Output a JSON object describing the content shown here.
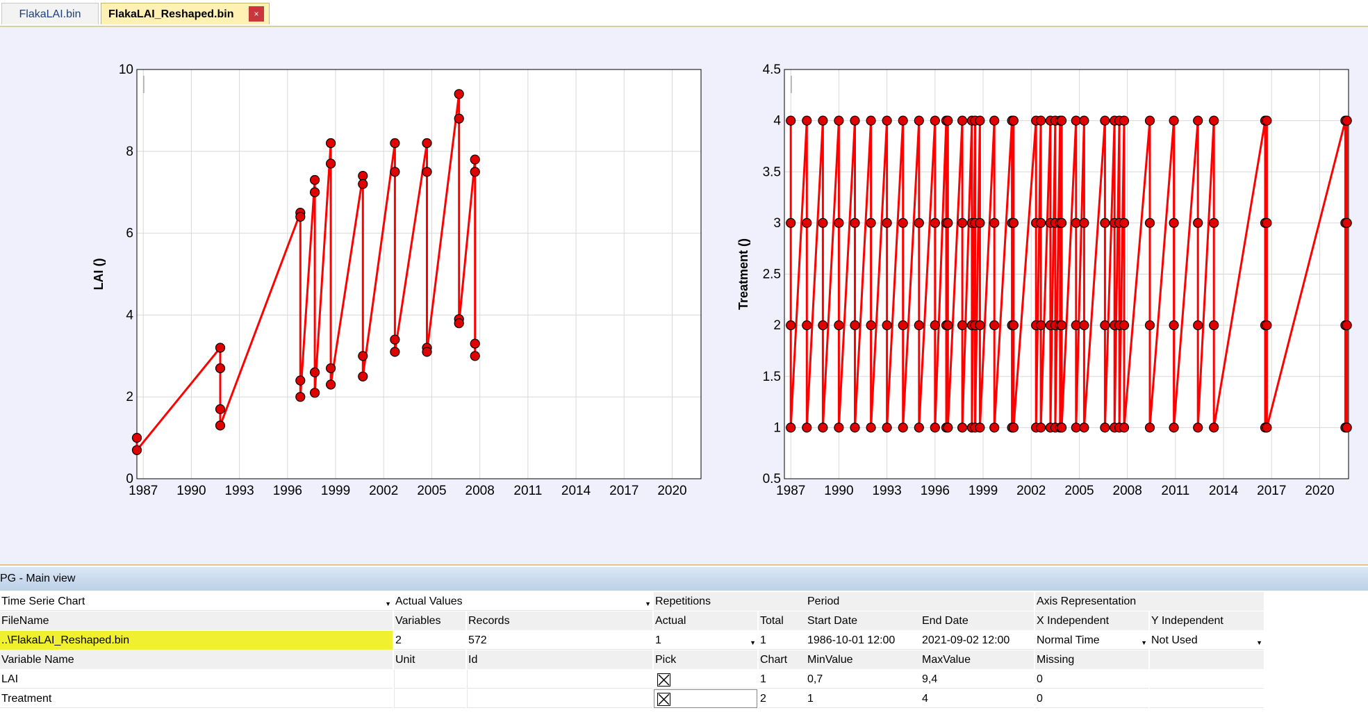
{
  "tabs": [
    {
      "label": "FlakaLAI.bin"
    },
    {
      "label": "FlakaLAI_Reshaped.bin",
      "close_icon": "close-icon"
    }
  ],
  "panel": {
    "title": "PG - Main view"
  },
  "grid": {
    "row0": {
      "chart_type": "Time Serie Chart",
      "value_type": "Actual Values",
      "repetitions": "Repetitions",
      "period": "Period",
      "axis_rep": "Axis Representation"
    },
    "row1": {
      "filename": "FileName",
      "variables": "Variables",
      "records": "Records",
      "actual": "Actual",
      "total": "Total",
      "start_date": "Start Date",
      "end_date": "End Date",
      "x_indep": "X Independent",
      "y_indep": "Y Independent"
    },
    "row2": {
      "filename": "..\\FlakaLAI_Reshaped.bin",
      "variables": "2",
      "records": "572",
      "actual": "1",
      "total": "1",
      "start_date": "1986-10-01 12:00",
      "end_date": "2021-09-02 12:00",
      "x_indep": "Normal Time",
      "y_indep": "Not Used"
    },
    "row3": {
      "variable_name": "Variable Name",
      "unit": "Unit",
      "id": "Id",
      "pick": "Pick",
      "chart": "Chart",
      "minvalue": "MinValue",
      "maxvalue": "MaxValue",
      "missing": "Missing"
    },
    "variables": [
      {
        "name": "LAI",
        "unit": "",
        "id": "",
        "picked": true,
        "chart": "1",
        "min": "0,7",
        "max": "9,4",
        "missing": "0"
      },
      {
        "name": "Treatment",
        "unit": "",
        "id": "",
        "picked": true,
        "chart": "2",
        "min": "1",
        "max": "4",
        "missing": "0"
      }
    ]
  },
  "colors": {
    "series": "#ff0000",
    "marker": "#e00000",
    "accent_highlight": "#f0f030",
    "plot_bg": "#f0f0fc"
  },
  "chart_data": [
    {
      "type": "line",
      "ylabel": "LAI ()",
      "xlabel": "",
      "xlim": [
        1986.6,
        2021.8
      ],
      "ylim": [
        0,
        10
      ],
      "xticks": [
        "1987",
        "1990",
        "1993",
        "1996",
        "1999",
        "2002",
        "2005",
        "2008",
        "2011",
        "2014",
        "2017",
        "2020"
      ],
      "yticks": [
        "0",
        "2",
        "4",
        "6",
        "8",
        "10"
      ],
      "grid": true,
      "series": [
        {
          "values": [
            [
              1986.6,
              1.0
            ],
            [
              1986.6,
              0.7
            ],
            [
              1991.8,
              3.2
            ],
            [
              1991.8,
              2.7
            ],
            [
              1991.8,
              1.7
            ],
            [
              1991.8,
              1.3
            ],
            [
              1996.8,
              6.5
            ],
            [
              1996.8,
              6.4
            ],
            [
              1996.8,
              2.4
            ],
            [
              1996.8,
              2.0
            ],
            [
              1997.7,
              7.3
            ],
            [
              1997.7,
              7.0
            ],
            [
              1997.7,
              2.6
            ],
            [
              1997.7,
              2.1
            ],
            [
              1998.7,
              8.2
            ],
            [
              1998.7,
              7.7
            ],
            [
              1998.7,
              2.7
            ],
            [
              1998.7,
              2.3
            ],
            [
              2000.7,
              7.4
            ],
            [
              2000.7,
              7.2
            ],
            [
              2000.7,
              3.0
            ],
            [
              2000.7,
              2.5
            ],
            [
              2002.7,
              8.2
            ],
            [
              2002.7,
              7.5
            ],
            [
              2002.7,
              3.4
            ],
            [
              2002.7,
              3.1
            ],
            [
              2004.7,
              8.2
            ],
            [
              2004.7,
              7.5
            ],
            [
              2004.7,
              3.2
            ],
            [
              2004.7,
              3.1
            ],
            [
              2006.7,
              9.4
            ],
            [
              2006.7,
              8.8
            ],
            [
              2006.7,
              3.9
            ],
            [
              2006.7,
              3.8
            ],
            [
              2007.7,
              7.8
            ],
            [
              2007.7,
              7.5
            ],
            [
              2007.7,
              3.3
            ],
            [
              2007.7,
              3.0
            ]
          ]
        }
      ]
    },
    {
      "type": "line",
      "ylabel": "Treatment ()",
      "xlabel": "",
      "xlim": [
        1986.6,
        2021.8
      ],
      "ylim": [
        0.5,
        4.5
      ],
      "xticks": [
        "1987",
        "1990",
        "1993",
        "1996",
        "1999",
        "2002",
        "2005",
        "2008",
        "2011",
        "2014",
        "2017",
        "2020"
      ],
      "yticks": [
        "0.5",
        "1",
        "1.5",
        "2",
        "2.5",
        "3",
        "3.5",
        "4",
        "4.5"
      ],
      "grid": true,
      "event_years": [
        1987.0,
        1988.0,
        1989.0,
        1990.0,
        1991.0,
        1992.0,
        1993.0,
        1994.0,
        1995.0,
        1996.0,
        1996.7,
        1996.8,
        1997.7,
        1998.3,
        1998.5,
        1998.8,
        1999.7,
        2000.8,
        2000.9,
        2002.3,
        2002.6,
        2003.2,
        2003.5,
        2003.8,
        2003.9,
        2004.8,
        2005.3,
        2006.6,
        2007.2,
        2007.5,
        2007.8,
        2009.4,
        2010.9,
        2012.4,
        2013.4,
        2016.6,
        2016.7,
        2021.6,
        2021.7
      ],
      "series": [
        {
          "pattern": [
            4,
            3,
            2,
            1
          ]
        }
      ]
    }
  ]
}
